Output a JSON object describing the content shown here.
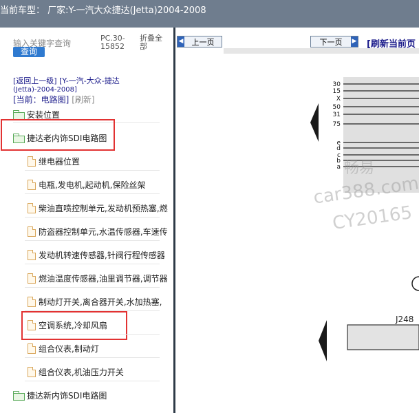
{
  "title_bar": {
    "text": "当前车型： 厂家:Y-一汽大众捷达(Jetta)2004-2008"
  },
  "search": {
    "placeholder": "输入关键字查询",
    "button_label": "查询"
  },
  "pc_info": {
    "line1": "PC.30-",
    "line2": "15852"
  },
  "collapse_label": {
    "line1": "折叠全",
    "line2": "部"
  },
  "breadcrumb": {
    "back": "[返回上一级]",
    "model": "[Y-一汽-大众-捷达",
    "model_sub": "(Jetta)-2004-2008]"
  },
  "current": {
    "label": "[当前：电路图]",
    "refresh": "[刷新]"
  },
  "tree": {
    "install_position": "安装位置",
    "old_interior_folder": "捷达老内饰SDI电路图",
    "children": [
      "继电器位置",
      "电瓶,发电机,起动机,保险丝架",
      "柴油直喷控制单元,发动机预热塞,燃",
      "防盗器控制单元,水温传感器,车速传",
      "发动机转速传感器,针阀行程传感器",
      "燃油温度传感器,油里调节器,调节器",
      "制动灯开关,离合器开关,水加热塞,",
      "空调系统,冷却风扇",
      "组合仪表,制动灯",
      "组合仪表,机油压力开关"
    ],
    "new_interior_folder": "捷达新内饰SDI电路图"
  },
  "viewer": {
    "prev_label": "上一页",
    "next_label": "下一页",
    "refresh_label": "[刷新当前页",
    "diagram": {
      "upper_labels": [
        "30",
        "15",
        "X",
        "50",
        "31",
        "75"
      ],
      "lower_labels": [
        "e",
        "d",
        "c",
        "b",
        "a"
      ],
      "component_label": "J248",
      "watermarks": [
        "畅易",
        "car388.com",
        "CY20165"
      ]
    }
  },
  "colors": {
    "title_bg": "#6f7d8e",
    "link": "#1a1a8a",
    "highlight": "#e23232",
    "search_button": "#2f7ad0"
  }
}
